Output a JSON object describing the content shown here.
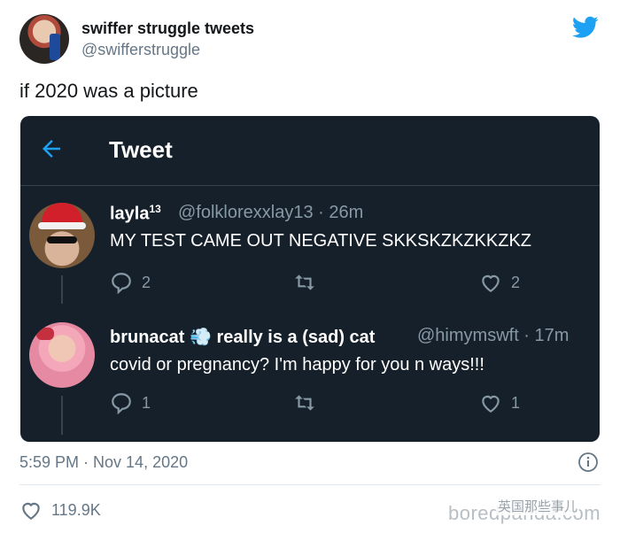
{
  "outer": {
    "display_name": "swiffer struggle tweets",
    "handle": "@swifferstruggle",
    "text": "if 2020 was a picture",
    "timestamp": "5:59 PM · Nov 14, 2020",
    "likes": "119.9K"
  },
  "inner": {
    "header_title": "Tweet",
    "tweets": [
      {
        "name": "layla",
        "name_sup": "13",
        "meta": "@folklorexxlay13 · 26m",
        "text": "MY TEST CAME OUT NEGATIVE SKKSKZKZKKZKZ",
        "replies": "2",
        "likes": "2"
      },
      {
        "name": "brunacat 💨 really is a (sad) cat",
        "meta": "@himymswft · 17m",
        "text": "covid or pregnancy? I'm happy for you n ways!!!",
        "replies": "1",
        "likes": "1"
      }
    ]
  },
  "watermark": {
    "text": "boredpanda.com",
    "wechat": "英国那些事儿"
  },
  "colors": {
    "dark_bg": "#15202b",
    "twitter_blue": "#1da1f2",
    "muted": "#8899a6"
  }
}
